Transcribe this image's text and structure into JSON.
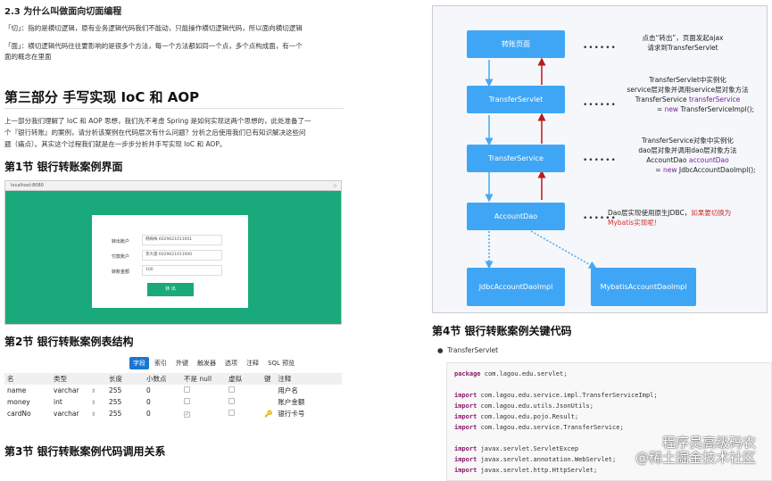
{
  "left": {
    "sec23_title": "2.3 为什么叫做面向切面编程",
    "cut_para": "「切」：指的是横切逻辑，原有业务逻辑代码我们不能动，只能操作横切逻辑代码，所以面向横切逻辑",
    "face_para_l1": "「面」：横切逻辑代码往往要影响的是很多个方法，每一个方法都如同一个点，多个点构成面，有一个",
    "face_para_l2": "面的概念在里面",
    "part3_title": "第三部分 手写实现 IoC 和 AOP",
    "intro_l1": "上一部分我们理解了 IoC 和 AOP 思想，我们先不考虑 Spring 是如何实现这两个思想的，此处准备了一",
    "intro_l2": "个『银行转账』的案例，请分析该案例在代码层次有什么问题？分析之后使用我们已有知识解决这些问",
    "intro_l3": "题（痛点）。其实这个过程我们就是在一步步分析并手写实现 IoC 和 AOP。",
    "sec1_title": "第1节 银行转账案例界面",
    "browser": {
      "url": "localhost:8080",
      "star": "☆",
      "from_label": "转出账户",
      "from_value": "韩梅梅 6029621011001",
      "to_label": "付款账户",
      "to_value": "李大雷 6029621011000",
      "amount_label": "转账金额",
      "amount_value": "100",
      "button": "转 出"
    },
    "sec2_title": "第2节 银行转账案例表结构",
    "tabs": [
      "字段",
      "索引",
      "外键",
      "触发器",
      "选项",
      "注释",
      "SQL 预览"
    ],
    "table": {
      "headers": [
        "名",
        "类型",
        "",
        "长度",
        "小数点",
        "不是 null",
        "虚拟",
        "键",
        "注释"
      ],
      "rows": [
        {
          "name": "name",
          "type": "varchar",
          "len": "255",
          "dec": "0",
          "notnull": "",
          "virtual": "",
          "key": "",
          "comment": "用户名"
        },
        {
          "name": "money",
          "type": "int",
          "len": "255",
          "dec": "0",
          "notnull": "",
          "virtual": "",
          "key": "",
          "comment": "账户金额"
        },
        {
          "name": "cardNo",
          "type": "varchar",
          "len": "255",
          "dec": "0",
          "notnull": "✓",
          "virtual": "",
          "key": "🔑",
          "comment": "银行卡号"
        }
      ]
    },
    "sec3_title": "第3节 银行转账案例代码调用关系"
  },
  "right": {
    "boxes": {
      "page": "转账页面",
      "servlet": "TransferServlet",
      "service": "TransferService",
      "dao": "AccountDao",
      "jdbc": "JdbcAccountDaoImpl",
      "mybatis": "MybatisAccountDaoImpl"
    },
    "dots": "••••••",
    "notes": {
      "n1_l1": "点击“转出”，页面发起ajax",
      "n1_l2": "请求到TransferServlet",
      "n2_l1": "TransferServlet中实例化",
      "n2_l2": "service层对象并调用service层对象方法",
      "n2_l3a": "TransferService ",
      "n2_l3b": "transferService",
      "n2_l4a": "= ",
      "n2_l4b": "new",
      "n2_l4c": " TransferServiceImpl();",
      "n3_l1": "TransferService对象中实例化",
      "n3_l2": "dao层对象并调用dao层对象方法",
      "n3_l3a": "AccountDao ",
      "n3_l3b": "accountDao",
      "n3_l4a": "= ",
      "n3_l4b": "new",
      "n3_l4c": " JdbcAccountDaoImpl();",
      "n4_a": "Dao层实现使用原生JDBC，",
      "n4_b": "如果要切换为",
      "n4_c": "Mybatis实现呢！"
    },
    "sec4_title": "第4节 银行转账案例关键代码",
    "bullet": "TransferServlet",
    "code": [
      {
        "kw": "package",
        "rest": " com.lagou.edu.servlet;"
      },
      {
        "kw": "",
        "rest": ""
      },
      {
        "kw": "import",
        "rest": " com.lagou.edu.service.impl.TransferServiceImpl;"
      },
      {
        "kw": "import",
        "rest": " com.lagou.edu.utils.JsonUtils;"
      },
      {
        "kw": "import",
        "rest": " com.lagou.edu.pojo.Result;"
      },
      {
        "kw": "import",
        "rest": " com.lagou.edu.service.TransferService;"
      },
      {
        "kw": "",
        "rest": ""
      },
      {
        "kw": "import",
        "rest": " javax.servlet.ServletExcep"
      },
      {
        "kw": "import",
        "rest": " javax.servlet.annotation.WebServlet;"
      },
      {
        "kw": "import",
        "rest": " javax.servlet.http.HttpServlet;"
      }
    ],
    "watermark_l1": "程序员高级码农",
    "watermark_l2": "@稀土掘金技术社区"
  }
}
